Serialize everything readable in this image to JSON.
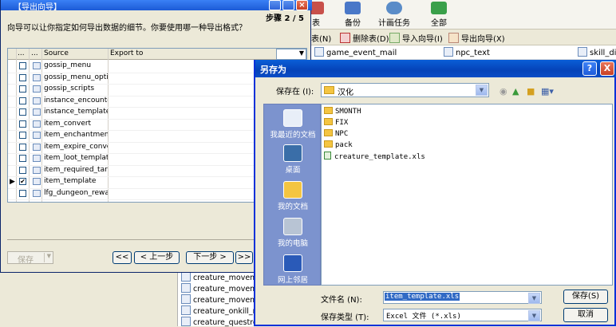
{
  "background": {
    "toolbar": [
      {
        "label": "表",
        "color": "#c8504a"
      },
      {
        "label": "备份",
        "color": "#4a78c8"
      },
      {
        "label": "计画任务",
        "color": "#5a8cc8"
      },
      {
        "label": "全部",
        "color": "#3aa04a"
      }
    ],
    "subbar": [
      "表(N)",
      "删除表(D)",
      "导入向导(I)",
      "导出向导(X)"
    ],
    "tables": [
      "game_event_mail",
      "npc_text",
      "skill_disco"
    ],
    "left_list": [
      "creature_movemen",
      "creature_movemen",
      "creature_movemen",
      "creature_onkill_repu",
      "creature_questrelati"
    ]
  },
  "wizard": {
    "title": "【导出向导】",
    "step": "步骤 2 / 5",
    "description": "向导可以让你指定如何导出数据的细节。你要使用哪一种导出格式？",
    "columns": [
      "...",
      "...",
      "Source",
      "Export to"
    ],
    "rows": [
      {
        "name": "gossip_menu",
        "checked": false,
        "current": false
      },
      {
        "name": "gossip_menu_option",
        "checked": false,
        "current": false
      },
      {
        "name": "gossip_scripts",
        "checked": false,
        "current": false
      },
      {
        "name": "instance_encounters",
        "checked": false,
        "current": false
      },
      {
        "name": "instance_template",
        "checked": false,
        "current": false
      },
      {
        "name": "item_convert",
        "checked": false,
        "current": false
      },
      {
        "name": "item_enchantment_template",
        "checked": false,
        "current": false
      },
      {
        "name": "item_expire_convert",
        "checked": false,
        "current": false
      },
      {
        "name": "item_loot_template",
        "checked": false,
        "current": false
      },
      {
        "name": "item_required_target",
        "checked": false,
        "current": false
      },
      {
        "name": "item_template",
        "checked": true,
        "current": true
      },
      {
        "name": "lfg_dungeon_rewards",
        "checked": false,
        "current": false
      }
    ],
    "buttons": {
      "save": "保存",
      "first": "<<",
      "prev": "< 上一步",
      "next": "下一步 >",
      "last": ">>"
    }
  },
  "save_as": {
    "title": "另存为",
    "help": "?",
    "close": "X",
    "save_in_label": "保存在 (I):",
    "save_in_value": "汉化",
    "places": [
      "我最近的文档",
      "桌面",
      "我的文档",
      "我的电脑",
      "网上邻居"
    ],
    "files": [
      {
        "name": "SMONTH",
        "kind": "folder"
      },
      {
        "name": "FIX",
        "kind": "folder"
      },
      {
        "name": "NPC",
        "kind": "folder"
      },
      {
        "name": "pack",
        "kind": "folder"
      },
      {
        "name": "creature_template.xls",
        "kind": "xls"
      }
    ],
    "filename_label": "文件名 (N):",
    "filename_value": "item_template.xls",
    "filetype_label": "保存类型 (T):",
    "filetype_value": "Excel 文件 (*.xls)",
    "save_button": "保存(S)",
    "cancel_button": "取消"
  }
}
